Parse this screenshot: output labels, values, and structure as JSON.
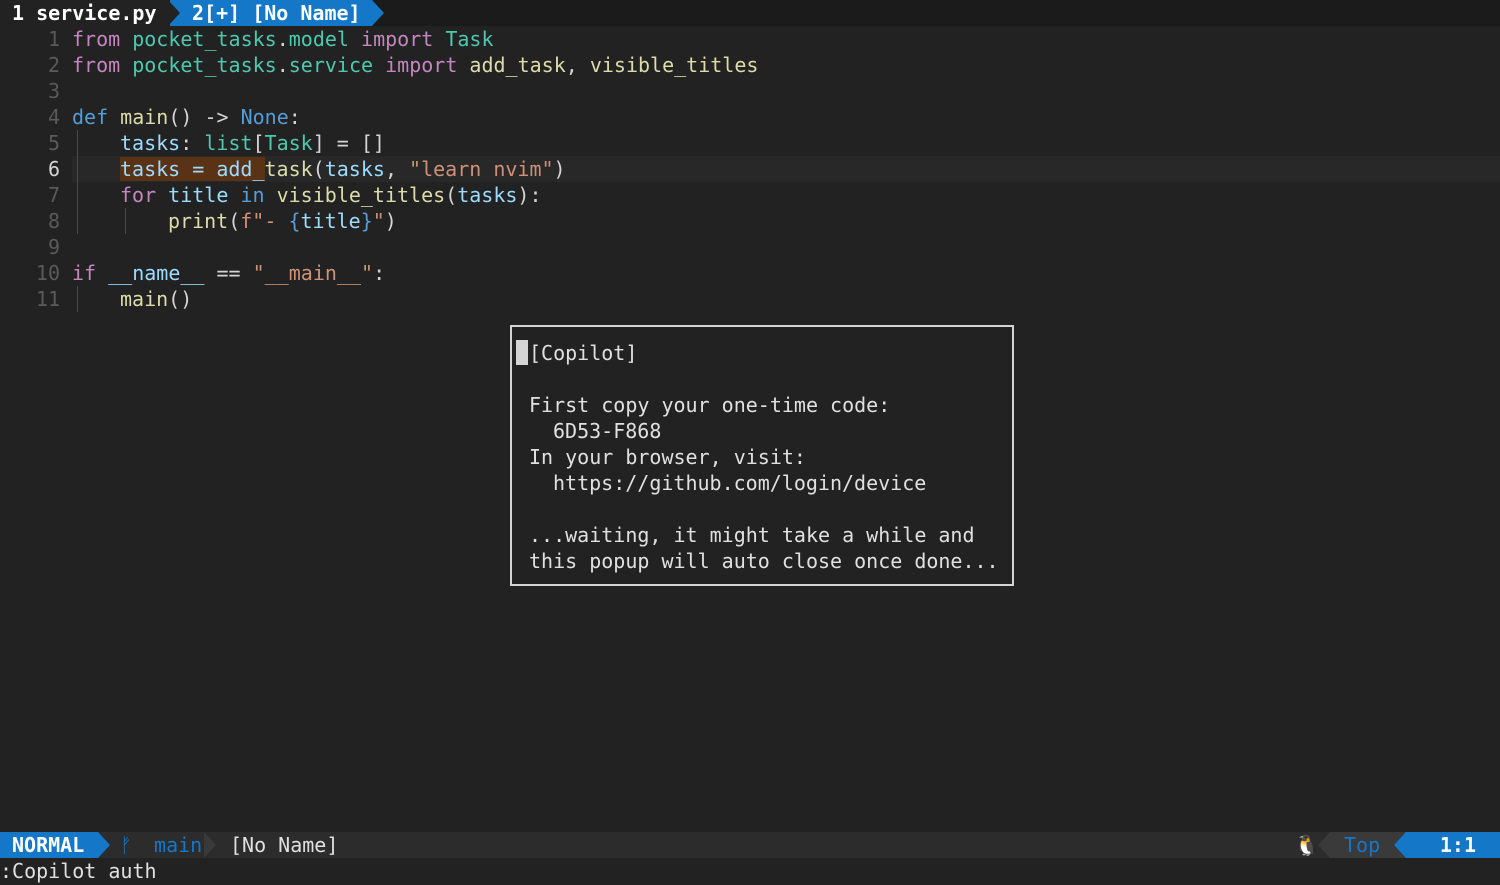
{
  "tabline": {
    "active_tab": "1 service.py",
    "inactive_tab": "2[+] [No Name]"
  },
  "editor": {
    "line_numbers": [
      "1",
      "2",
      "3",
      "4",
      "5",
      "6",
      "7",
      "8",
      "9",
      "10",
      "11"
    ],
    "lines": {
      "l1": {
        "t1": "from",
        "t2": " ",
        "t3": "pocket_tasks",
        "t4": ".",
        "t5": "model",
        "t6": " ",
        "t7": "import",
        "t8": " ",
        "t9": "Task"
      },
      "l2": {
        "t1": "from",
        "t2": " ",
        "t3": "pocket_tasks",
        "t4": ".",
        "t5": "service",
        "t6": " ",
        "t7": "import",
        "t8": " ",
        "t9": "add_task",
        "t10": ", ",
        "t11": "visible_titles"
      },
      "l4": {
        "t1": "def",
        "t2": " ",
        "t3": "main",
        "t4": "() -> ",
        "t5": "None",
        "t6": ":"
      },
      "l5": {
        "t1": "tasks",
        "t2": ": ",
        "t3": "list",
        "t4": "[",
        "t5": "Task",
        "t6": "] = []"
      },
      "l6": {
        "t1": "tasks = add_",
        "t2": "task",
        "t3": "(",
        "t4": "tasks",
        "t5": ", ",
        "t6": "\"learn nvim\"",
        "t7": ")"
      },
      "l7": {
        "t1": "for",
        "t2": " ",
        "t3": "title",
        "t4": " ",
        "t5": "in",
        "t6": " ",
        "t7": "visible_titles",
        "t8": "(",
        "t9": "tasks",
        "t10": "):"
      },
      "l8": {
        "t1": "print",
        "t2": "(",
        "t3": "f\"- ",
        "t4": "{",
        "t5": "title",
        "t6": "}",
        "t7": "\"",
        "t8": ")"
      },
      "l10": {
        "t1": "if",
        "t2": " ",
        "t3": "__name__",
        "t4": " == ",
        "t5": "\"__main__\"",
        "t6": ":"
      },
      "l11": {
        "t1": "main",
        "t2": "()"
      }
    }
  },
  "popup": {
    "title": "[Copilot]",
    "line1": "First copy your one-time code:",
    "code": "6D53-F868",
    "line2": "In your browser, visit:",
    "url": "https://github.com/login/device",
    "line3": "...waiting, it might take a while and",
    "line4": "this popup will auto close once done..."
  },
  "statusline": {
    "mode": "NORMAL",
    "branch_icon": "",
    "branch": "main",
    "filename": "[No Name]",
    "os_icon": "linux-tux-icon",
    "scroll": "Top",
    "position": "1:1"
  },
  "cmdline": {
    "text": ":Copilot auth"
  },
  "colors": {
    "background": "#222222",
    "accent": "#1577c8",
    "keyword": "#c586c0",
    "string": "#ce9178",
    "module": "#4ec9b0",
    "function": "#dcdcaa",
    "variable": "#9cdcfe",
    "highlight": "#5a3216"
  }
}
